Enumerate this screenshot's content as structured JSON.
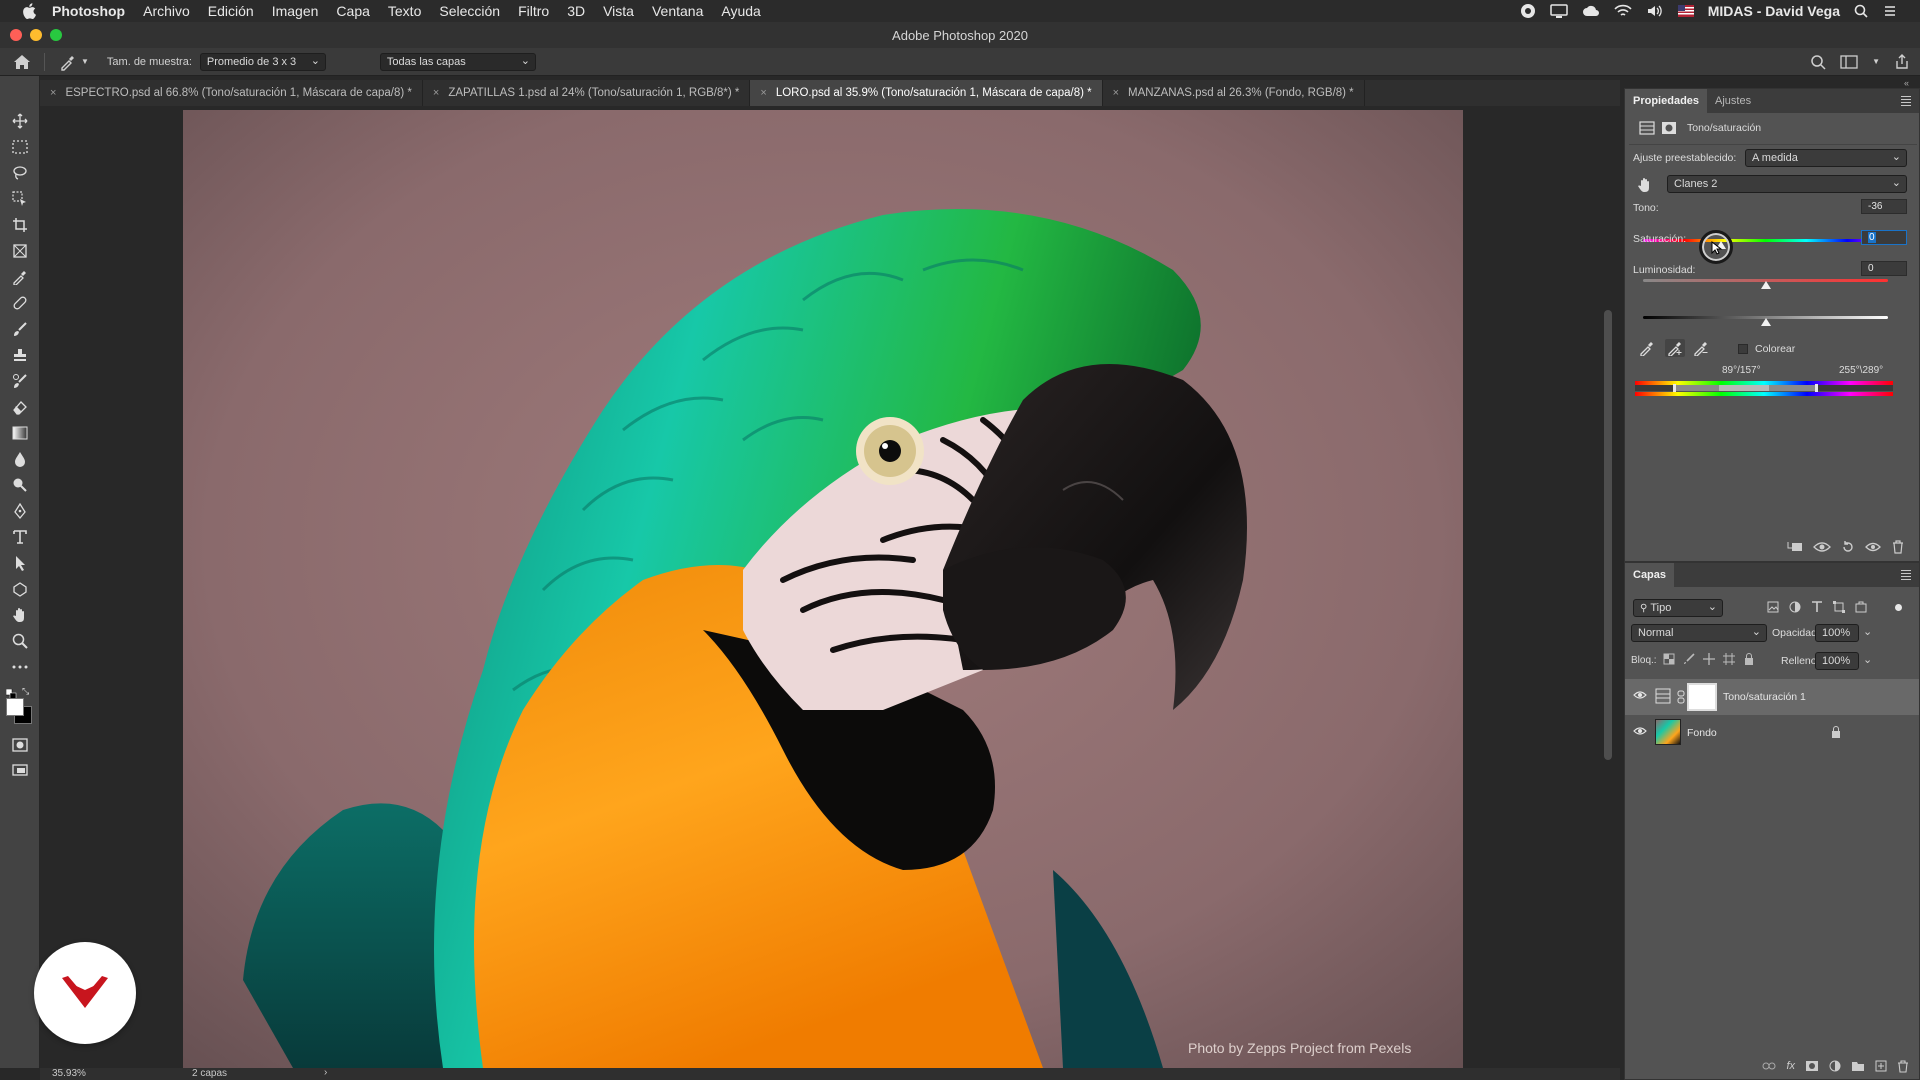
{
  "menubar": {
    "app_name": "Photoshop",
    "items": [
      "Archivo",
      "Edición",
      "Imagen",
      "Capa",
      "Texto",
      "Selección",
      "Filtro",
      "3D",
      "Vista",
      "Ventana",
      "Ayuda"
    ],
    "user": "MIDAS - David Vega"
  },
  "window": {
    "title": "Adobe Photoshop 2020"
  },
  "options_bar": {
    "sample_size_label": "Tam. de muestra:",
    "sample_size_value": "Promedio de 3 x 3",
    "sample_layers_value": "Todas las capas"
  },
  "document_tabs": [
    {
      "label": "ESPECTRO.psd al 66.8% (Tono/saturación 1, Máscara de capa/8) *",
      "active": false
    },
    {
      "label": "ZAPATILLAS 1.psd al 24% (Tono/saturación 1, RGB/8*) *",
      "active": false
    },
    {
      "label": "LORO.psd al 35.9% (Tono/saturación 1, Máscara de capa/8) *",
      "active": true
    },
    {
      "label": "MANZANAS.psd al 26.3% (Fondo, RGB/8) *",
      "active": false
    }
  ],
  "properties_panel": {
    "tabs": [
      "Propiedades",
      "Ajustes"
    ],
    "active_tab": "Propiedades",
    "adjustment_name": "Tono/saturación",
    "preset_label": "Ajuste preestablecido:",
    "preset_value": "A medida",
    "channel_value": "Clanes 2",
    "hue": {
      "label": "Tono:",
      "value": "-36",
      "fraction": 0.32
    },
    "saturation": {
      "label": "Saturación:",
      "value": "0",
      "fraction": 0.5
    },
    "lightness": {
      "label": "Luminosidad:",
      "value": "0",
      "fraction": 0.5
    },
    "colorize_label": "Colorear",
    "colorize_checked": false,
    "range_left": "89°/157°",
    "range_right": "255°\\289°"
  },
  "layers_panel": {
    "title": "Capas",
    "filter_value": "Tipo",
    "blend_mode": "Normal",
    "opacity_label": "Opacidad:",
    "opacity_value": "100%",
    "lock_label": "Bloq.:",
    "fill_label": "Relleno:",
    "fill_value": "100%",
    "layers": [
      {
        "name": "Tono/saturación 1",
        "visible": true,
        "selected": true
      },
      {
        "name": "Fondo",
        "visible": true,
        "selected": false,
        "locked": true
      }
    ]
  },
  "status_bar": {
    "zoom": "35.93%",
    "doc_info": "2 capas"
  },
  "canvas": {
    "credit": "Photo by Zepps Project from Pexels"
  },
  "colors": {
    "background": "#282828",
    "panel": "#535353",
    "toolbar": "#434343",
    "active_tab": "#454545",
    "accent_selection": "#1a73c8",
    "brand_logo": "#c8151e"
  },
  "icons": {
    "toolbar": [
      "move",
      "marquee",
      "lasso",
      "object-selection",
      "crop",
      "frame",
      "eyedropper",
      "healing-brush",
      "brush",
      "clone-stamp",
      "history-brush",
      "eraser",
      "gradient",
      "blur",
      "dodge",
      "pen",
      "type",
      "path-selection",
      "shape",
      "hand",
      "zoom",
      "more-tools"
    ]
  }
}
